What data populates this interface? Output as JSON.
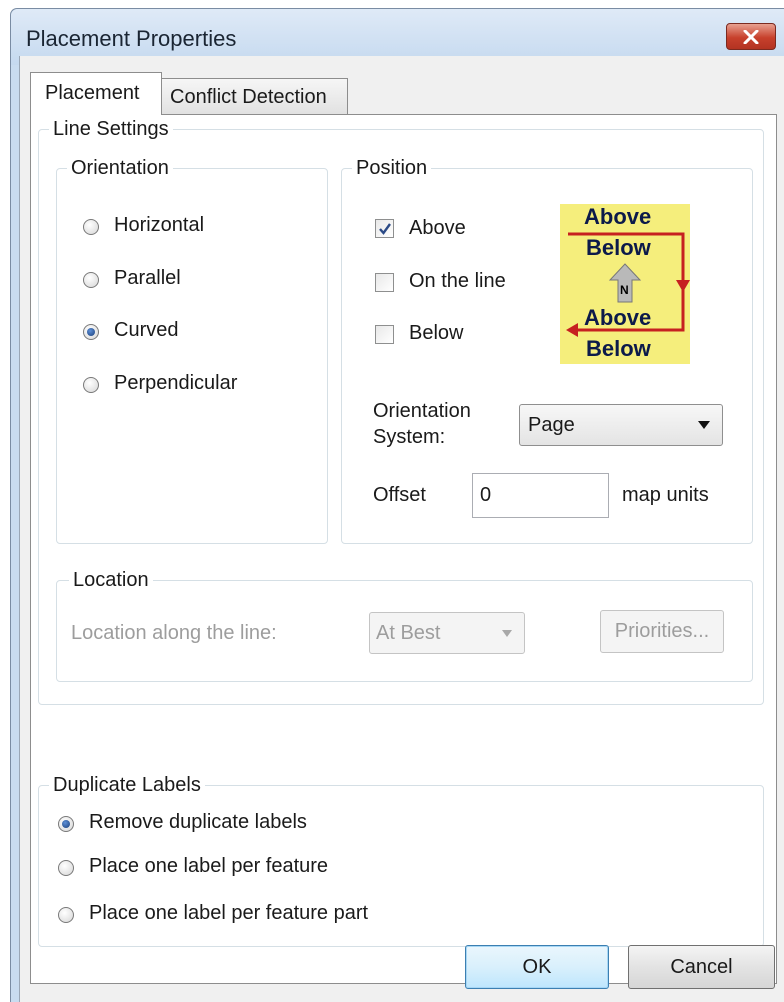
{
  "window": {
    "title": "Placement Properties"
  },
  "tabs": [
    {
      "label": "Placement",
      "active": true
    },
    {
      "label": "Conflict Detection",
      "active": false
    }
  ],
  "line_settings": {
    "legend": "Line Settings",
    "orientation": {
      "legend": "Orientation",
      "options": [
        "Horizontal",
        "Parallel",
        "Curved",
        "Perpendicular"
      ],
      "selected": "Curved"
    },
    "position": {
      "legend": "Position",
      "checkboxes": [
        {
          "label": "Above",
          "checked": true
        },
        {
          "label": "On the line",
          "checked": false
        },
        {
          "label": "Below",
          "checked": false
        }
      ],
      "illustration": {
        "labels": [
          "Above",
          "Below",
          "Above",
          "Below"
        ],
        "north": "N"
      },
      "orientation_system_label_1": "Orientation",
      "orientation_system_label_2": "System:",
      "orientation_system_value": "Page",
      "offset_label": "Offset",
      "offset_value": "0",
      "offset_units": "map units"
    },
    "location": {
      "legend": "Location",
      "along_label": "Location along the line:",
      "along_value": "At Best",
      "priorities_button": "Priorities..."
    }
  },
  "duplicate_labels": {
    "legend": "Duplicate Labels",
    "options": [
      "Remove duplicate labels",
      "Place one label per feature",
      "Place one label per feature part"
    ],
    "selected": "Remove duplicate labels"
  },
  "buttons": {
    "ok": "OK",
    "cancel": "Cancel"
  },
  "colors": {
    "illustration_bg": "#f5ee7c",
    "arrow": "#c62020",
    "titlebar": "#c5d9ef",
    "close": "#c7402c"
  }
}
